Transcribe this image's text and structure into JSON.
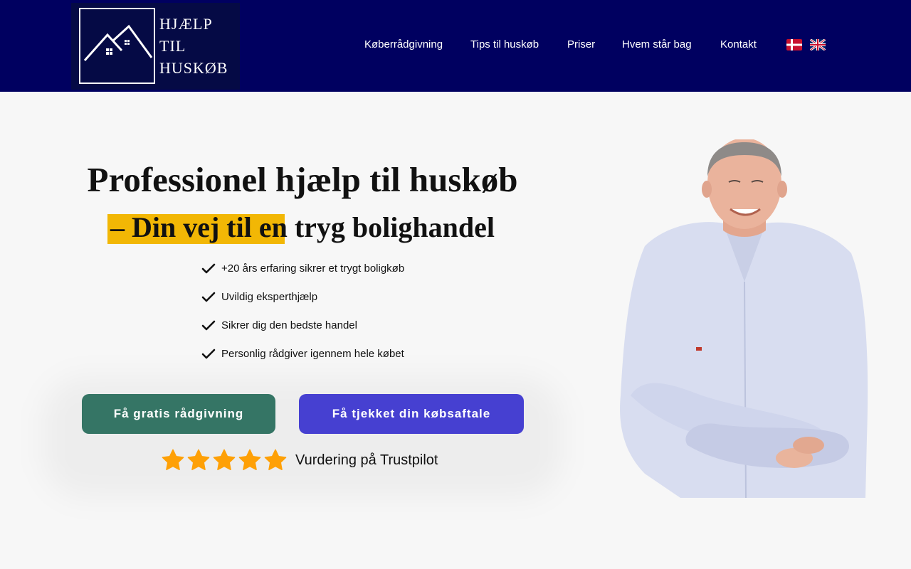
{
  "header": {
    "logo_lines": [
      "HJÆLP",
      "TIL",
      "HUSKØB"
    ],
    "nav": [
      "Køberrådgivning",
      "Tips til huskøb",
      "Priser",
      "Hvem står bag",
      "Kontakt"
    ],
    "languages": [
      {
        "code": "da",
        "icon": "danish-flag-icon"
      },
      {
        "code": "en",
        "icon": "uk-flag-icon"
      }
    ],
    "colors": {
      "background": "#000060",
      "text": "#ffffff"
    }
  },
  "hero": {
    "title": "Professionel hjælp til huskøb",
    "subtitle_highlight": "– Din vej til en",
    "subtitle_rest": " tryg bolighandel",
    "highlight_color": "#f2b705",
    "checklist": [
      "+20 års erfaring sikrer et trygt boligkøb",
      "Uvildig eksperthjælp",
      "Sikrer dig den bedste handel",
      "Personlig rådgiver igennem hele købet"
    ],
    "buttons": {
      "primary": {
        "label": "Få gratis rådgivning",
        "color": "#357565"
      },
      "secondary": {
        "label": "Få tjekket din købsaftale",
        "color": "#4640d1"
      }
    },
    "rating": {
      "stars": 5,
      "label": "Vurdering på Trustpilot",
      "star_color": "#fea006"
    }
  }
}
